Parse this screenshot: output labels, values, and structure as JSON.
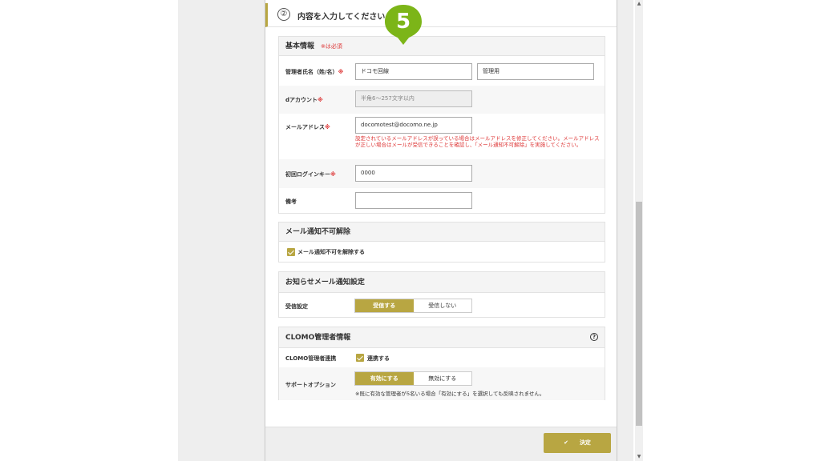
{
  "header": {
    "step": "②",
    "title": "内容を入力してください"
  },
  "marker": {
    "number": "5"
  },
  "basic": {
    "title": "基本情報",
    "required_note": "※は必須",
    "name_label": "管理者氏名（姓/名）",
    "req_mark": "※",
    "last_name_value": "ドコモ回線",
    "first_name_value": "管理用",
    "account_label": "dアカウント",
    "account_placeholder": "半角6～257文字以内",
    "email_label": "メールアドレス",
    "email_value": "docomotest@docomo.ne.jp",
    "email_warning": "設定されているメールアドレスが誤っている場合はメールアドレスを修正してください。メールアドレスが正しい場合はメールが受信できることを確認し、「メール通知不可解除」を実施してください。",
    "login_key_label": "初回ログインキー",
    "login_key_value": "0000",
    "memo_label": "備考",
    "memo_value": ""
  },
  "mail_block": {
    "title": "メール通知不可解除",
    "checkbox_label": "メール通知不可を解除する"
  },
  "notice": {
    "title": "お知らせメール通知設定",
    "receive_label": "受信設定",
    "on_label": "受信する",
    "off_label": "受信しない"
  },
  "clomo": {
    "title": "CLOMO管理者情報",
    "help_icon": "?",
    "link_label": "CLOMO管理者連携",
    "link_checkbox_label": "連携する",
    "support_label": "サポートオプション",
    "enable_label": "有効にする",
    "disable_label": "無効にする",
    "support_note": "※既に有効な管理者が5名いる場合「有効にする」を選択しても反映されません。"
  },
  "footer": {
    "submit_label": "決定",
    "submit_icon": "✔"
  },
  "scrollbar": {
    "up": "▲",
    "down": "▼"
  },
  "colors": {
    "accent": "#b8a642",
    "marker": "#7cb518",
    "required": "#dd3333"
  }
}
